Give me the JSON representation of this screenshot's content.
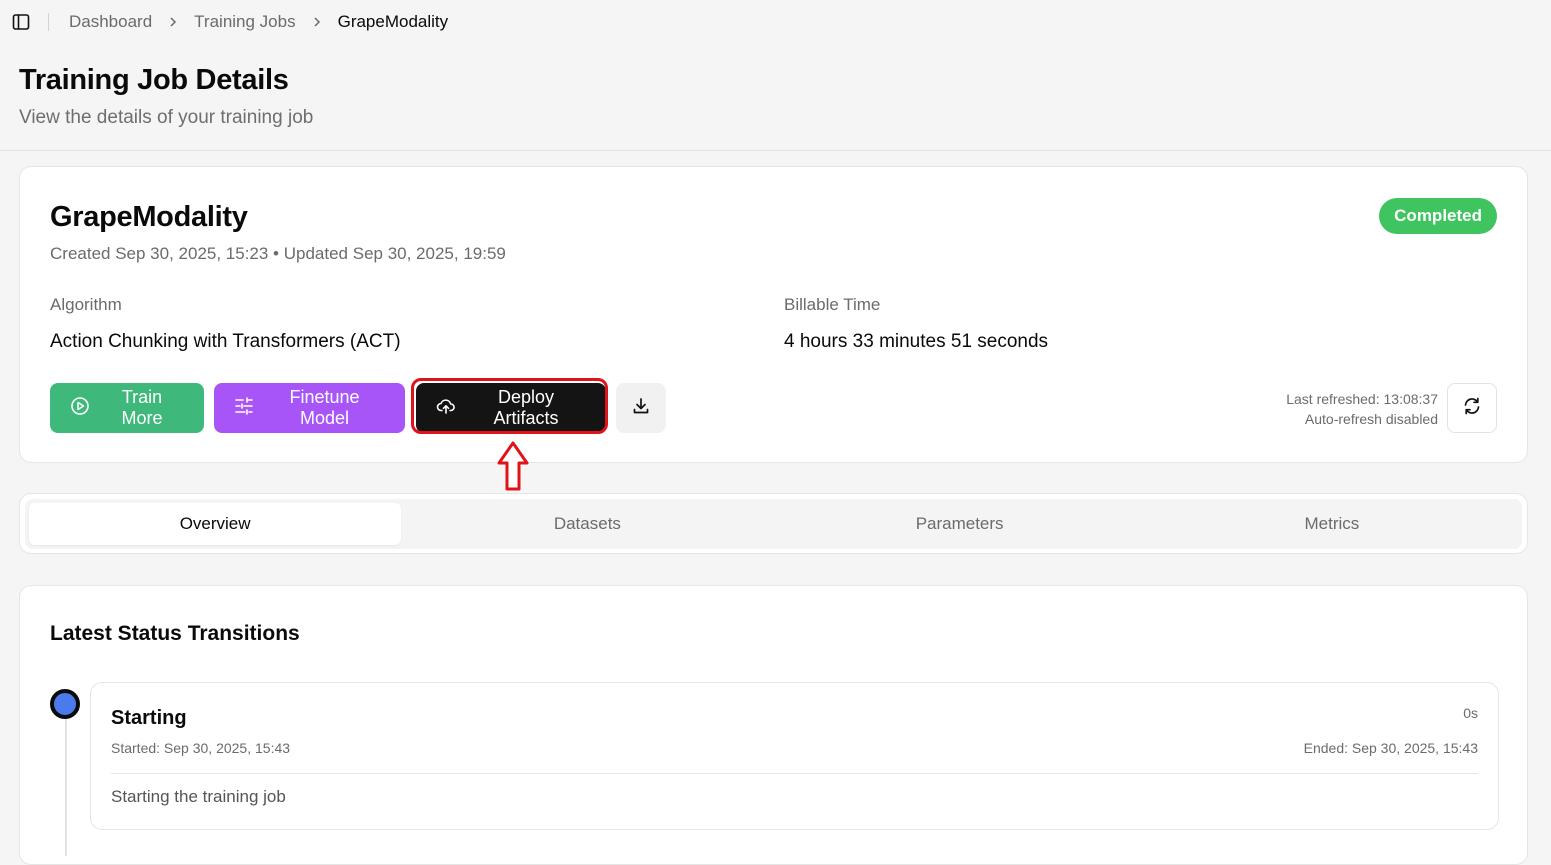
{
  "breadcrumb": {
    "items": [
      "Dashboard",
      "Training Jobs"
    ],
    "current": "GrapeModality"
  },
  "page": {
    "title": "Training Job Details",
    "subtitle": "View the details of your training job"
  },
  "job": {
    "name": "GrapeModality",
    "meta": "Created Sep 30, 2025, 15:23 • Updated Sep 30, 2025, 19:59",
    "status": "Completed",
    "status_color": "#3fc460",
    "algorithm_label": "Algorithm",
    "algorithm_value": "Action Chunking with Transformers (ACT)",
    "billable_label": "Billable Time",
    "billable_value": "4 hours 33 minutes 51 seconds"
  },
  "actions": {
    "train_more": "Train More",
    "finetune": "Finetune Model",
    "deploy": "Deploy Artifacts",
    "download_icon": "download-icon",
    "refresh_icon": "refresh-icon"
  },
  "refresh": {
    "last_refreshed": "Last refreshed: 13:08:37",
    "auto_refresh": "Auto-refresh disabled"
  },
  "tabs": [
    "Overview",
    "Datasets",
    "Parameters",
    "Metrics"
  ],
  "active_tab": "Overview",
  "status_section": {
    "title": "Latest Status Transitions",
    "transitions": [
      {
        "title": "Starting",
        "duration": "0s",
        "started": "Started: Sep 30, 2025, 15:43",
        "ended": "Ended: Sep 30, 2025, 15:43",
        "message": "Starting the training job"
      }
    ]
  },
  "colors": {
    "train": "#3fb97b",
    "finetune": "#a855f7",
    "deploy": "#141414",
    "highlight": "#e0121a",
    "timeline_dot": "#4a7aec"
  }
}
